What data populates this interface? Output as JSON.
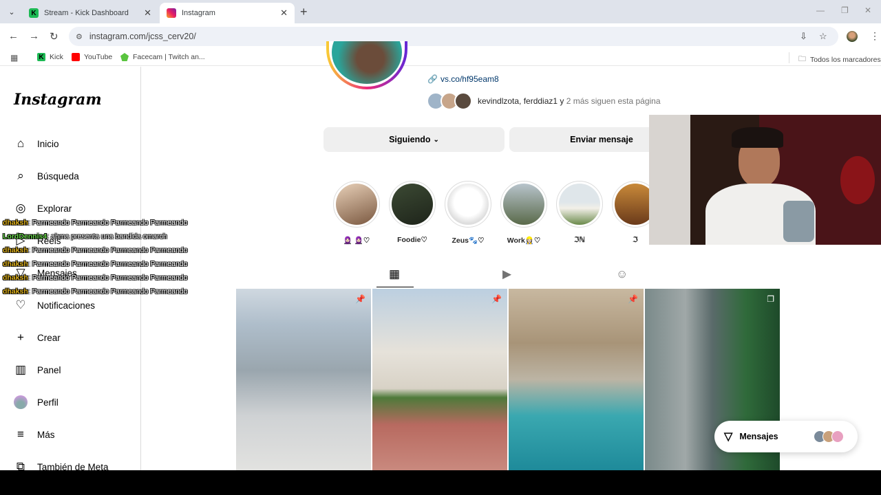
{
  "browser": {
    "tabs": [
      {
        "title": "Stream - Kick Dashboard",
        "favicon": "kick-icon"
      },
      {
        "title": "Instagram",
        "favicon": "instagram-icon"
      }
    ],
    "url": "instagram.com/jcss_cerv20/",
    "bookmarks": [
      {
        "label": "Kick",
        "icon": "kick-icon"
      },
      {
        "label": "YouTube",
        "icon": "youtube-icon"
      },
      {
        "label": "Facecam | Twitch an...",
        "icon": "facecam-icon"
      }
    ],
    "all_bookmarks": "Todos los marcadores"
  },
  "instagram": {
    "logo": "Instagram",
    "nav": [
      {
        "label": "Inicio",
        "icon": "home-icon"
      },
      {
        "label": "Búsqueda",
        "icon": "search-icon"
      },
      {
        "label": "Explorar",
        "icon": "compass-icon"
      },
      {
        "label": "Reels",
        "icon": "reels-icon"
      },
      {
        "label": "Mensajes",
        "icon": "messenger-icon"
      },
      {
        "label": "Notificaciones",
        "icon": "heart-icon"
      },
      {
        "label": "Crear",
        "icon": "plus-icon"
      },
      {
        "label": "Panel",
        "icon": "chart-icon"
      },
      {
        "label": "Perfil",
        "icon": "avatar"
      },
      {
        "label": "Más",
        "icon": "menu-icon"
      },
      {
        "label": "También de Meta",
        "icon": "meta-icon"
      }
    ],
    "profile": {
      "link": "vs.co/hf95eam8",
      "followed_by_names": "kevindlzota, ferddiaz1",
      "followed_by_mid": " y ",
      "followed_by_more": "2 más siguen esta página",
      "following_btn": "Siguiendo",
      "message_btn": "Enviar mensaje"
    },
    "highlights": [
      {
        "label": "🧕🏻 🧕🏻♡"
      },
      {
        "label": "Foodie♡"
      },
      {
        "label": "Zeus🐾♡"
      },
      {
        "label": "Work👷🏻‍♀️♡"
      },
      {
        "label": "ℑℕ"
      },
      {
        "label": "ℑ"
      }
    ],
    "messages_pill": "Mensajes"
  },
  "chat": [
    {
      "user": "dhaksh",
      "text": ": Parmeando Parmeando Parmeando Parmeando",
      "color": "#e0b21c"
    },
    {
      "user": "LordDennis4",
      "text": ": ahma presenta una bandida omarch",
      "color": "#67d64a"
    },
    {
      "user": "dhaksh",
      "text": ": Parmeando Parmeando Parmeando Parmeando",
      "color": "#e0b21c"
    },
    {
      "user": "dhaksh",
      "text": ": Parmeando Parmeando Parmeando Parmeando",
      "color": "#e0b21c"
    },
    {
      "user": "dhaksh",
      "text": ": Parmeando Parmeando Parmeando Parmeando",
      "color": "#e0b21c"
    },
    {
      "user": "dhaksh",
      "text": ": Parmeando Parmeando Parmeando Parmeando",
      "color": "#e0b21c"
    }
  ]
}
